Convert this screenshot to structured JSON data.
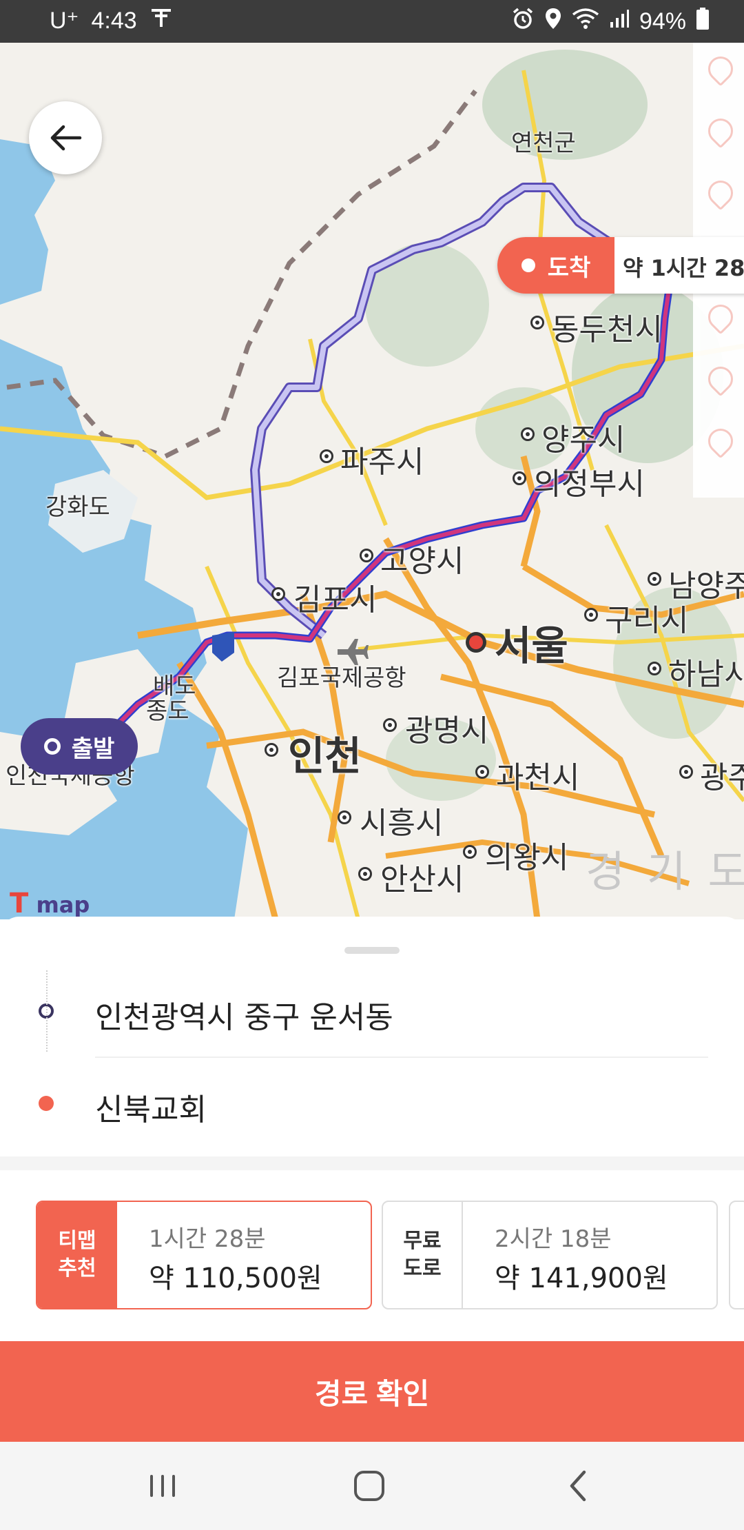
{
  "status_bar": {
    "carrier": "U⁺",
    "time": "4:43",
    "battery": "94%"
  },
  "map": {
    "places": {
      "yeoncheon": "연천군",
      "dongducheon": "동두천시",
      "yangju": "양주시",
      "paju": "파주시",
      "uijeongbu": "의정부시",
      "ganghwa": "강화도",
      "goyang": "고양시",
      "gimpo": "김포시",
      "namyang": "남양주",
      "guri": "구리시",
      "seoul": "서울",
      "gimpo_airport": "김포국제공항",
      "hanam": "하남시",
      "yeongjongdo_a": "배도",
      "yeongjongdo_b": "종도",
      "incheon": "인천",
      "gwangmyeong": "광명시",
      "incheon_airport": "인천국제공항",
      "gwacheon": "과천시",
      "gwangju": "광주",
      "siheung": "시흥시",
      "uiwang": "의왕시",
      "ansan": "안산시",
      "gyeonggi": "경 기 도"
    },
    "arrive_label": "도착",
    "arrive_time": "약 1시간 28",
    "depart_label": "출발",
    "logo_text": "map"
  },
  "sheet": {
    "origin": "인천광역시 중구 운서동",
    "destination": "신북교회"
  },
  "routes": [
    {
      "badge_line1": "티맵",
      "badge_line2": "추천",
      "duration": "1시간 28분",
      "price": "약 110,500원",
      "selected": true
    },
    {
      "badge_line1": "무료",
      "badge_line2": "도로",
      "duration": "2시간 18분",
      "price": "약 141,900원",
      "selected": false
    }
  ],
  "confirm_label": "경로 확인",
  "colors": {
    "accent": "#f26450",
    "route_primary": "#5a2a9a",
    "depart": "#4a3f8a"
  }
}
